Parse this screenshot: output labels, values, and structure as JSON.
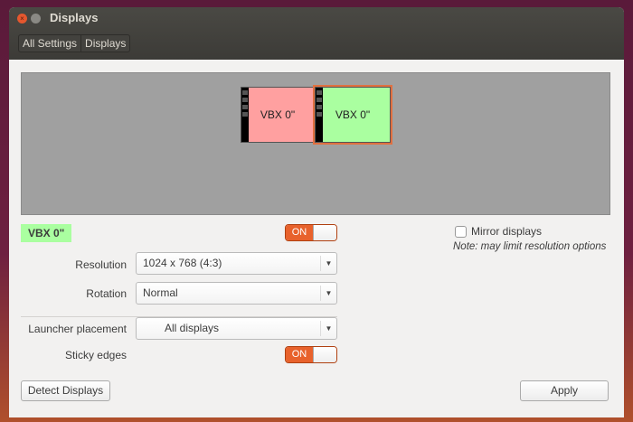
{
  "window": {
    "title": "Displays",
    "close_icon": "×"
  },
  "breadcrumb": [
    "All Settings",
    "Displays"
  ],
  "monitors": [
    {
      "label": "VBX 0\"",
      "color": "#ffa0a0"
    },
    {
      "label": "VBX 0\"",
      "color": "#aaffa0"
    }
  ],
  "selected_monitor": {
    "name": "VBX 0\"",
    "toggle": "ON"
  },
  "resolution": {
    "label": "Resolution",
    "value": "1024 x 768 (4:3)"
  },
  "rotation": {
    "label": "Rotation",
    "value": "Normal"
  },
  "launcher": {
    "label": "Launcher placement",
    "value": "All displays"
  },
  "sticky": {
    "label": "Sticky edges",
    "toggle": "ON"
  },
  "mirror": {
    "label": "Mirror displays",
    "checked": false,
    "note": "Note: may limit resolution options"
  },
  "buttons": {
    "detect": "Detect Displays",
    "apply": "Apply"
  },
  "arrow": "▼"
}
